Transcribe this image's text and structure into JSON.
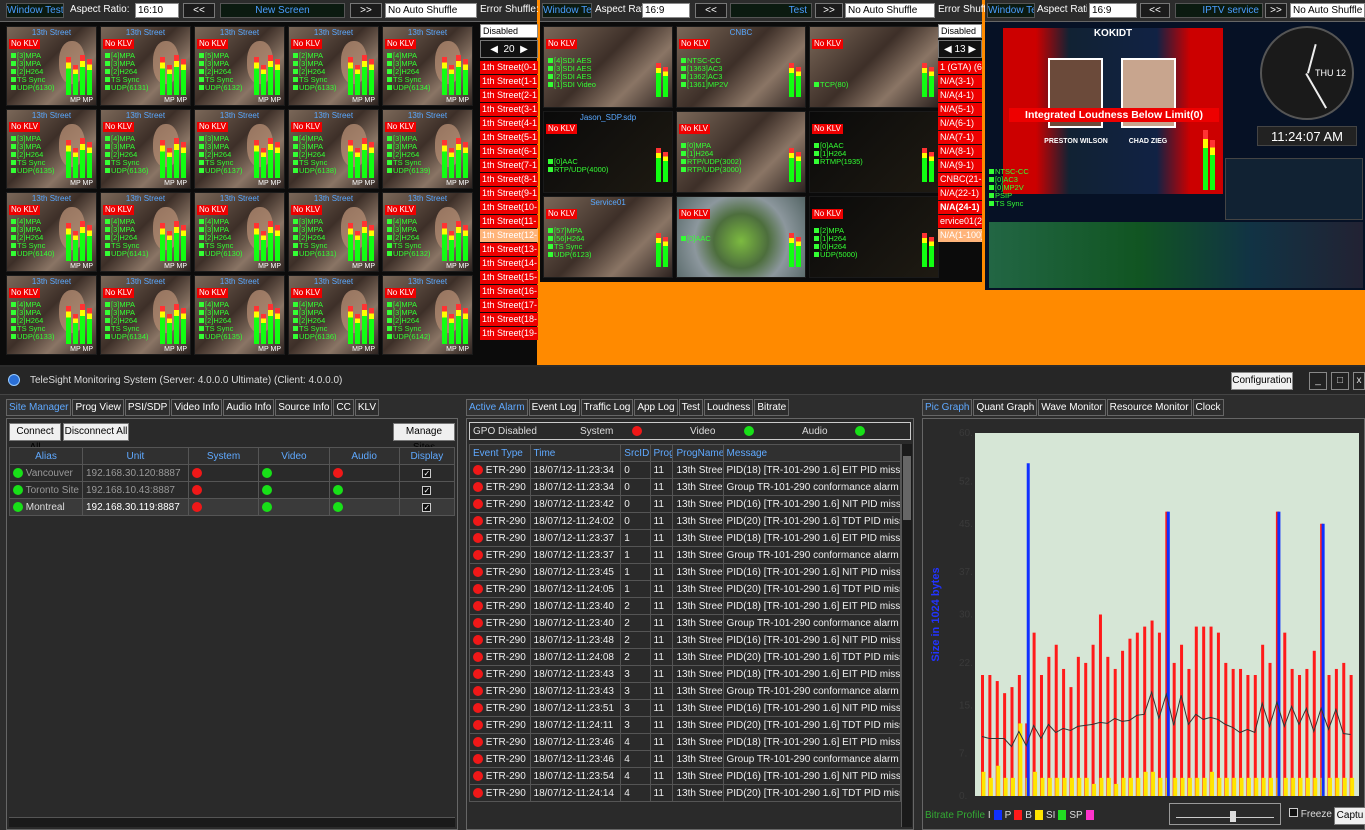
{
  "panelA": {
    "title_box": "Window Test",
    "aspect_label": "Aspect Ratio:",
    "aspect_value": "16:10",
    "prev": "<<",
    "screen_title": "New Screen",
    "next": ">>",
    "shuffle": "No Auto Shuffle",
    "error_shuffle": "Error Shuffle:",
    "error_value": "Disabled",
    "spin": "20",
    "side_items": [
      "1th Street(0-1",
      "1th Street(1-1",
      "1th Street(2-1",
      "1th Street(3-1",
      "1th Street(4-1",
      "1th Street(5-1",
      "1th Street(6-1",
      "1th Street(7-1",
      "1th Street(8-1",
      "1th Street(9-1",
      "1th Street(10-",
      "1th Street(11-",
      "1th Street(12-",
      "1th Street(13-",
      "1th Street(14-",
      "1th Street(15-",
      "1th Street(16-",
      "1th Street(17-",
      "1th Street(18-",
      "1th Street(19-"
    ],
    "cell_title": "13th Street",
    "klv": "No KLV",
    "mp": "MP  MP",
    "cells_info": [
      [
        "[3]MPA",
        "[3]MPA",
        "[2]H264",
        "TS Sync",
        "UDP(6130)"
      ],
      [
        "[4]MPA",
        "[3]MPA",
        "[2]H264",
        "TS Sync",
        "UDP(6131)"
      ],
      [
        "[5]MPA",
        "[3]MPA",
        "[2]H264",
        "TS Sync",
        "UDP(6132)"
      ],
      [
        "[2]MPA",
        "[3]MPA",
        "[2]H264",
        "TS Sync",
        "UDP(6133)"
      ],
      [
        "[4]MPA",
        "[3]MPA",
        "[2]H264",
        "TS Sync",
        "UDP(6134)"
      ],
      [
        "[3]MPA",
        "[3]MPA",
        "[2]H264",
        "TS Sync",
        "UDP(6135)"
      ],
      [
        "[4]MPA",
        "[3]MPA",
        "[2]H264",
        "TS Sync",
        "UDP(6136)"
      ],
      [
        "[3]MPA",
        "[3]MPA",
        "[2]H264",
        "TS Sync",
        "UDP(6137)"
      ],
      [
        "[4]MPA",
        "[3]MPA",
        "[2]H264",
        "TS Sync",
        "UDP(6138)"
      ],
      [
        "[3]MPA",
        "[3]MPA",
        "[2]H264",
        "TS Sync",
        "UDP(6139)"
      ],
      [
        "[4]MPA",
        "[3]MPA",
        "[2]H264",
        "TS Sync",
        "UDP(6140)"
      ],
      [
        "[4]MPA",
        "[3]MPA",
        "[2]H264",
        "TS Sync",
        "UDP(6141)"
      ],
      [
        "[4]MPA",
        "[3]MPA",
        "[2]H264",
        "TS Sync",
        "UDP(6130)"
      ],
      [
        "[3]MPA",
        "[3]MPA",
        "[2]H264",
        "TS Sync",
        "UDP(6131)"
      ],
      [
        "[4]MPA",
        "[3]MPA",
        "[2]H264",
        "TS Sync",
        "UDP(6132)"
      ],
      [
        "[4]MPA",
        "[3]MPA",
        "[2]H264",
        "TS Sync",
        "UDP(6133)"
      ],
      [
        "[3]MPA",
        "[3]MPA",
        "[2]H264",
        "TS Sync",
        "UDP(6134)"
      ],
      [
        "[4]MPA",
        "[3]MPA",
        "[2]H264",
        "TS Sync",
        "UDP(6135)"
      ],
      [
        "[4]MPA",
        "[3]MPA",
        "[2]H264",
        "TS Sync",
        "UDP(6136)"
      ],
      [
        "[4]MPA",
        "[3]MPA",
        "[2]H264",
        "TS Sync",
        "UDP(6142)"
      ]
    ]
  },
  "panelB": {
    "title_box": "Window Test",
    "aspect_label": "Aspect Rat",
    "aspect_value": "16:9",
    "prev": "<<",
    "screen_title": "Test",
    "next": ">>",
    "shuffle": "No Auto Shuffle",
    "error_shuffle": "Error Shuffle:",
    "error_value": "Disabled",
    "spin": "13",
    "side_items": [
      "1 (GTA) (640)",
      "N/A(3-1)",
      "N/A(4-1)",
      "N/A(5-1)",
      "N/A(6-1)",
      "N/A(7-1)",
      "N/A(8-1)",
      "N/A(9-1)",
      "CNBC(21-51)",
      "N/A(22-1)",
      "N/A(24-1)",
      "ervice01(26-1",
      "N/A(1-100)"
    ],
    "cells": [
      {
        "t": "",
        "i": [
          "[4]SDI AES",
          "[3]SDI AES",
          "[2]SDI AES",
          "[1]SDI Video"
        ]
      },
      {
        "t": "CNBC",
        "i": [
          "NTSC-CC",
          "[1363]AC3",
          "[1362]AC3",
          "[1361]MP2V"
        ]
      },
      {
        "t": "",
        "i": [
          "",
          "",
          "",
          "TCP(80)"
        ]
      },
      {
        "t": "Jason_SDP.sdp",
        "i": [
          "",
          "",
          "[0]AAC",
          "RTP/UDP(4000)"
        ]
      },
      {
        "t": "",
        "i": [
          "[0]MPA",
          "[1]H264",
          "RTP/UDP(3002)",
          "RTP/UDP(3000)"
        ]
      },
      {
        "t": "",
        "i": [
          "[0]AAC",
          "[1]H264",
          "RTMP(1935)",
          ""
        ]
      },
      {
        "t": "Service01",
        "i": [
          "[57]MPA",
          "[56]H264",
          "TS Sync",
          "UDP(6123)"
        ]
      },
      {
        "t": "",
        "i": [
          "",
          "[0]AAC",
          "",
          ""
        ]
      },
      {
        "t": "",
        "i": [
          "[2]MPA",
          "[1]H264",
          "[0]H264",
          "UDP(5000)"
        ]
      }
    ]
  },
  "panelC": {
    "title_box": "Window Test",
    "aspect_label": "Aspect Rati",
    "aspect_value": "16:9",
    "prev": "<<",
    "screen_title": "IPTV service",
    "next": ">>",
    "shuffle": "No Auto Shuffle",
    "big_title": "KOKIDT",
    "loudness": "Integrated Loudness Below Limit(0)",
    "name1": "PRESTON WILSON",
    "name2": "CHAD ZIEG",
    "clock_time": "11:24:07 AM",
    "clock_day": "THU 12",
    "left_info": [
      "NTSC-CC",
      "[0]AC3",
      "[0]MP2V",
      "PSIP",
      "TS Sync"
    ]
  },
  "app": {
    "title": "TeleSight Monitoring System (Server: 4.0.0.0 Ultimate) (Client: 4.0.0.0)",
    "config": "Configuration",
    "left_tabs": [
      "Site Manager",
      "Prog View",
      "PSI/SDP",
      "Video Info",
      "Audio Info",
      "Source Info",
      "CC",
      "KLV"
    ],
    "connect_all": "Connect All",
    "disconnect_all": "Disconnect All",
    "manage_sites": "Manage Sites",
    "site_cols": [
      "Alias",
      "Unit",
      "System",
      "Video",
      "Audio",
      "Display"
    ],
    "sites": [
      {
        "alias": "Vancouver",
        "unit": "192.168.30.120:8887",
        "system": "red",
        "video": "green",
        "audio": "red"
      },
      {
        "alias": "Toronto Site",
        "unit": "192.168.10.43:8887",
        "system": "red",
        "video": "green",
        "audio": "green"
      },
      {
        "alias": "Montreal",
        "unit": "192.168.30.119:8887",
        "system": "red",
        "video": "green",
        "audio": "green"
      }
    ],
    "mid_tabs": [
      "Active Alarm",
      "Event Log",
      "Traffic Log",
      "App Log",
      "Test",
      "Loudness",
      "Bitrate"
    ],
    "gpo": "GPO Disabled",
    "sys_label": "System",
    "video_label": "Video",
    "audio_label": "Audio",
    "alarm_cols": [
      "Event Type",
      "Time",
      "SrcID",
      "ProgI",
      "ProgName",
      "Message"
    ],
    "alarms": [
      [
        "ETR-290",
        "18/07/12-11:23:34",
        "0",
        "11",
        "13th Street",
        "PID(18) [TR-101-290 1.6] EIT PID missi..."
      ],
      [
        "ETR-290",
        "18/07/12-11:23:34",
        "0",
        "11",
        "13th Street",
        "Group TR-101-290 conformance alarm"
      ],
      [
        "ETR-290",
        "18/07/12-11:23:42",
        "0",
        "11",
        "13th Street",
        "PID(16) [TR-101-290 1.6] NIT PID missi..."
      ],
      [
        "ETR-290",
        "18/07/12-11:24:02",
        "0",
        "11",
        "13th Street",
        "PID(20) [TR-101-290 1.6] TDT PID miss..."
      ],
      [
        "ETR-290",
        "18/07/12-11:23:37",
        "1",
        "11",
        "13th Street",
        "PID(18) [TR-101-290 1.6] EIT PID missi..."
      ],
      [
        "ETR-290",
        "18/07/12-11:23:37",
        "1",
        "11",
        "13th Street",
        "Group TR-101-290 conformance alarm"
      ],
      [
        "ETR-290",
        "18/07/12-11:23:45",
        "1",
        "11",
        "13th Street",
        "PID(16) [TR-101-290 1.6] NIT PID missi..."
      ],
      [
        "ETR-290",
        "18/07/12-11:24:05",
        "1",
        "11",
        "13th Street",
        "PID(20) [TR-101-290 1.6] TDT PID miss..."
      ],
      [
        "ETR-290",
        "18/07/12-11:23:40",
        "2",
        "11",
        "13th Street",
        "PID(18) [TR-101-290 1.6] EIT PID missi..."
      ],
      [
        "ETR-290",
        "18/07/12-11:23:40",
        "2",
        "11",
        "13th Street",
        "Group TR-101-290 conformance alarm"
      ],
      [
        "ETR-290",
        "18/07/12-11:23:48",
        "2",
        "11",
        "13th Street",
        "PID(16) [TR-101-290 1.6] NIT PID missi..."
      ],
      [
        "ETR-290",
        "18/07/12-11:24:08",
        "2",
        "11",
        "13th Street",
        "PID(20) [TR-101-290 1.6] TDT PID miss..."
      ],
      [
        "ETR-290",
        "18/07/12-11:23:43",
        "3",
        "11",
        "13th Street",
        "PID(18) [TR-101-290 1.6] EIT PID missi..."
      ],
      [
        "ETR-290",
        "18/07/12-11:23:43",
        "3",
        "11",
        "13th Street",
        "Group TR-101-290 conformance alarm"
      ],
      [
        "ETR-290",
        "18/07/12-11:23:51",
        "3",
        "11",
        "13th Street",
        "PID(16) [TR-101-290 1.6] NIT PID missi..."
      ],
      [
        "ETR-290",
        "18/07/12-11:24:11",
        "3",
        "11",
        "13th Street",
        "PID(20) [TR-101-290 1.6] TDT PID miss..."
      ],
      [
        "ETR-290",
        "18/07/12-11:23:46",
        "4",
        "11",
        "13th Street",
        "PID(18) [TR-101-290 1.6] EIT PID missi..."
      ],
      [
        "ETR-290",
        "18/07/12-11:23:46",
        "4",
        "11",
        "13th Street",
        "Group TR-101-290 conformance alarm"
      ],
      [
        "ETR-290",
        "18/07/12-11:23:54",
        "4",
        "11",
        "13th Street",
        "PID(16) [TR-101-290 1.6] NIT PID missi..."
      ],
      [
        "ETR-290",
        "18/07/12-11:24:14",
        "4",
        "11",
        "13th Street",
        "PID(20) [TR-101-290 1.6] TDT PID miss..."
      ]
    ],
    "right_tabs": [
      "Pic Graph",
      "Quant Graph",
      "Wave Monitor",
      "Resource Monitor",
      "Clock"
    ],
    "freeze": "Freeze",
    "capture": "Captu",
    "legend_title": "Bitrate Profile",
    "legend": [
      {
        "k": "I",
        "c": "#1030ff"
      },
      {
        "k": "P",
        "c": "#ff1a1a"
      },
      {
        "k": "B",
        "c": "#ffe500"
      },
      {
        "k": "SI",
        "c": "#22dd22"
      },
      {
        "k": "SP",
        "c": "#ff33cc"
      }
    ]
  },
  "chart_data": {
    "type": "bar",
    "ylabel": "Size in 1024 bytes",
    "yticks": [
      0,
      7,
      15,
      22,
      30,
      37,
      45,
      52,
      60
    ],
    "ylim": [
      0,
      60
    ],
    "series": [
      {
        "name": "I",
        "values": [
          0,
          0,
          0,
          0,
          0,
          0,
          55,
          0,
          0,
          0,
          0,
          0,
          0,
          0,
          0,
          0,
          0,
          0,
          0,
          0,
          0,
          0,
          0,
          0,
          0,
          0,
          0,
          0,
          0,
          0,
          0,
          0,
          0,
          0,
          0,
          0,
          0,
          0,
          0,
          0,
          0,
          0,
          0,
          0,
          0,
          0,
          0,
          0,
          0,
          0,
          0,
          0,
          0,
          0,
          0,
          0,
          0,
          0,
          0,
          0,
          0,
          0,
          0,
          0,
          0,
          0,
          0,
          0,
          0,
          0,
          0,
          0,
          0,
          0,
          0,
          0,
          0,
          0,
          0,
          0,
          0,
          0,
          0,
          0,
          0,
          0,
          0,
          0,
          0,
          0
        ]
      },
      {
        "name": "P",
        "values": [
          20,
          20,
          19,
          17,
          18,
          20,
          12,
          27,
          20,
          23,
          25,
          21,
          18,
          23,
          22,
          25,
          30,
          23,
          21,
          24,
          26,
          27,
          28,
          29,
          27,
          47,
          22,
          25,
          21,
          28,
          28,
          28,
          27,
          22,
          21,
          21,
          20,
          20,
          25,
          22,
          47,
          27,
          21,
          20,
          21,
          24,
          45,
          20,
          21,
          22,
          20
        ]
      },
      {
        "name": "B",
        "values": [
          4,
          3,
          5,
          3,
          3,
          12,
          3,
          4,
          3,
          3,
          3,
          3,
          3,
          3,
          3,
          2,
          3,
          3,
          2,
          3,
          3,
          3,
          4,
          4,
          3,
          3,
          3,
          3,
          3,
          3,
          3,
          4,
          3,
          3,
          3,
          3,
          3,
          3,
          3,
          3,
          3,
          3,
          3,
          3,
          3,
          3,
          3,
          3,
          3,
          3,
          3
        ]
      }
    ]
  }
}
